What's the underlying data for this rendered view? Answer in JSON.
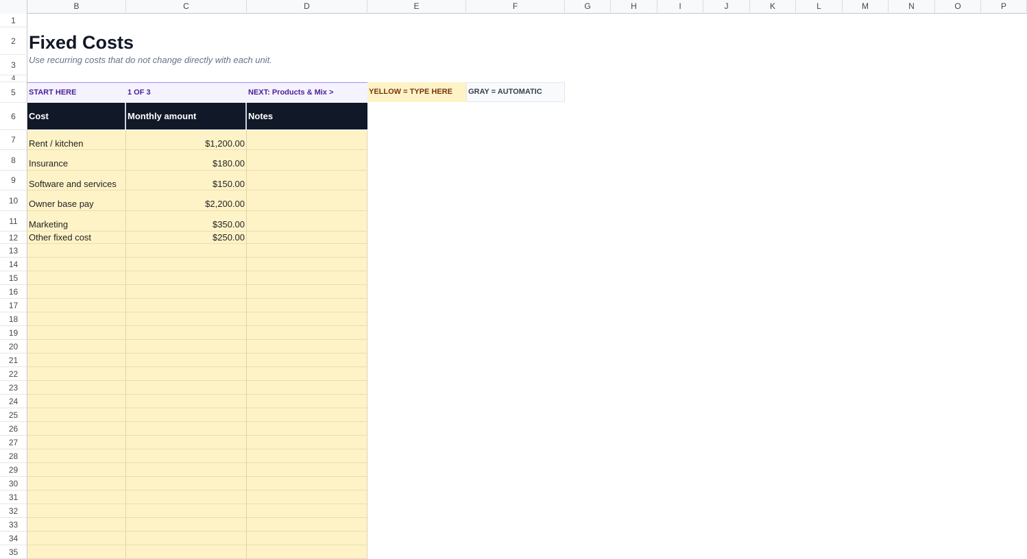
{
  "columns": [
    "B",
    "C",
    "D",
    "E",
    "F",
    "G",
    "H",
    "I",
    "J",
    "K",
    "L",
    "M",
    "N",
    "O",
    "P"
  ],
  "rows": [
    "1",
    "2",
    "3",
    "4",
    "5",
    "6",
    "7",
    "8",
    "9",
    "10",
    "11",
    "12",
    "13",
    "14",
    "15",
    "16",
    "17",
    "18",
    "19",
    "20",
    "21",
    "22",
    "23",
    "24",
    "25",
    "26",
    "27",
    "28",
    "29",
    "30",
    "31",
    "32",
    "33",
    "34",
    "35"
  ],
  "sheet": {
    "title": "Fixed Costs",
    "subtitle": "Use recurring costs that do not change directly with each unit.",
    "nav": {
      "start": "START HERE",
      "step": "1 OF 3",
      "next": "NEXT: Products & Mix  >"
    },
    "legend": {
      "yellow": "YELLOW = TYPE HERE",
      "gray": "GRAY = AUTOMATIC"
    },
    "table": {
      "headers": [
        "Cost",
        "Monthly amount",
        "Notes"
      ],
      "rows": [
        {
          "cost": "Rent / kitchen",
          "amount": "$1,200.00",
          "notes": ""
        },
        {
          "cost": "Insurance",
          "amount": "$180.00",
          "notes": ""
        },
        {
          "cost": "Software and services",
          "amount": "$150.00",
          "notes": ""
        },
        {
          "cost": "Owner base pay",
          "amount": "$2,200.00",
          "notes": ""
        },
        {
          "cost": "Marketing",
          "amount": "$350.00",
          "notes": ""
        },
        {
          "cost": "Other fixed cost",
          "amount": "$250.00",
          "notes": ""
        }
      ]
    }
  },
  "colors": {
    "header_bg": "#111827",
    "input_yellow": "#fef3c7",
    "nav_purple": "#4c1d95",
    "nav_bg": "#f5f3ff"
  }
}
